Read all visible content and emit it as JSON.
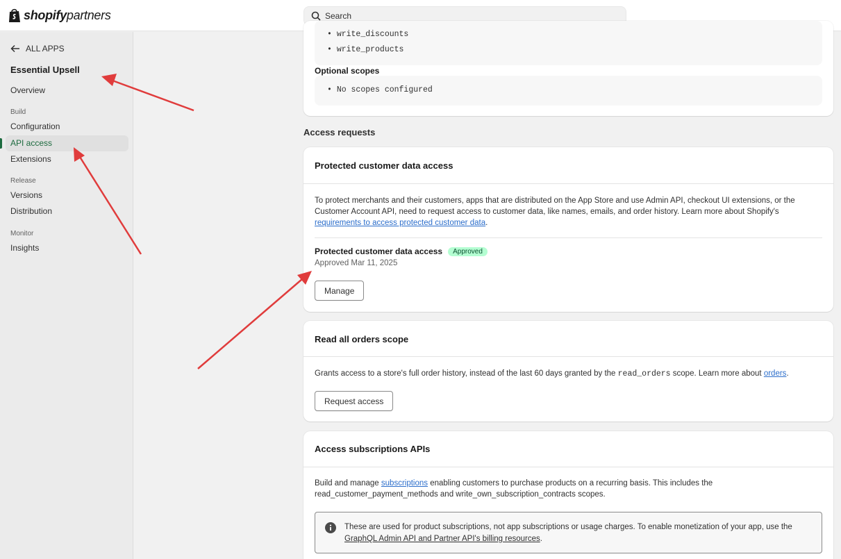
{
  "brand": {
    "bold": "shopify",
    "light": "partners"
  },
  "search": {
    "placeholder": "Search"
  },
  "sidebar": {
    "back_label": "ALL APPS",
    "app_name": "Essential Upsell",
    "overview": "Overview",
    "sections": {
      "build": "Build",
      "release": "Release",
      "monitor": "Monitor"
    },
    "items": {
      "configuration": "Configuration",
      "api_access": "API access",
      "extensions": "Extensions",
      "versions": "Versions",
      "distribution": "Distribution",
      "insights": "Insights"
    }
  },
  "scopes": {
    "required_items": [
      "write_discounts",
      "write_products"
    ],
    "optional_label": "Optional scopes",
    "optional_items": [
      "No scopes configured"
    ]
  },
  "access_requests": {
    "title": "Access requests",
    "protected": {
      "title": "Protected customer data access",
      "description": "To protect merchants and their customers, apps that are distributed on the App Store and use Admin API, checkout UI extensions, or the Customer Account API, need to request access to customer data, like names, emails, and order history. Learn more about Shopify's ",
      "link": "requirements to access protected customer data",
      "after_link": ".",
      "status_label": "Protected customer data access",
      "badge": "Approved",
      "approved_date": "Approved Mar 11, 2025",
      "button": "Manage"
    },
    "orders": {
      "title": "Read all orders scope",
      "description_before": "Grants access to a store's full order history, instead of the last 60 days granted by the ",
      "code": "read_orders",
      "description_after": " scope. Learn more about ",
      "link": "orders",
      "after_link": ".",
      "button": "Request access"
    },
    "subscriptions": {
      "title": "Access subscriptions APIs",
      "description_before": "Build and manage ",
      "link": "subscriptions",
      "description_after": " enabling customers to purchase products on a recurring basis. This includes the read_customer_payment_methods and write_own_subscription_contracts scopes.",
      "info_text": "These are used for product subscriptions, not app subscriptions or usage charges. To enable monetization of your app, use the ",
      "info_link": "GraphQL Admin API and Partner API's billing resources",
      "info_after": "."
    }
  },
  "colors": {
    "accent": "#1d6b3f",
    "link": "#2c6ecb",
    "badge_bg": "#b4fed2",
    "annotation_arrow": "#e03c3c"
  }
}
